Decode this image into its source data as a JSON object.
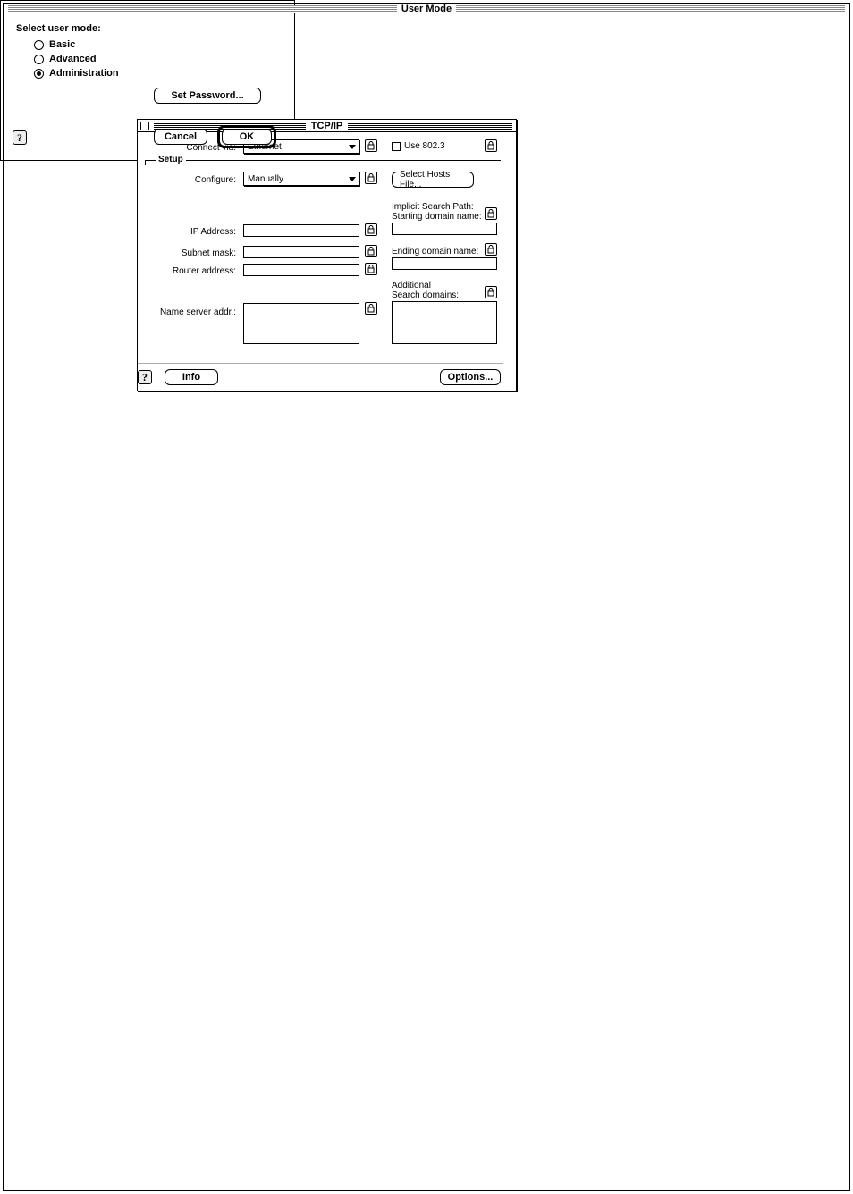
{
  "tcpip": {
    "title": "TCP/IP",
    "labels": {
      "connect_via": "Connect via:",
      "setup": "Setup",
      "configure": "Configure:",
      "ip_address": "IP Address:",
      "subnet_mask": "Subnet mask:",
      "router_address": "Router address:",
      "name_server": "Name server addr.:",
      "use_8023": "Use 802.3",
      "select_hosts": "Select Hosts File...",
      "implicit_search": "Implicit Search Path:",
      "starting_domain": "Starting domain name:",
      "ending_domain": "Ending domain name:",
      "additional": "Additional",
      "search_domains": "Search domains:"
    },
    "values": {
      "connect_via": "Ethernet",
      "configure": "Manually",
      "ip_address": "",
      "subnet_mask": "",
      "router_address": "",
      "name_server": "",
      "starting_domain": "",
      "ending_domain": "",
      "search_domains": ""
    },
    "buttons": {
      "info": "Info",
      "options": "Options..."
    }
  },
  "usermode": {
    "title": "User Mode",
    "heading": "Select user mode:",
    "options": {
      "basic": "Basic",
      "advanced": "Advanced",
      "administration": "Administration"
    },
    "selected": "administration",
    "buttons": {
      "set_password": "Set Password...",
      "cancel": "Cancel",
      "ok": "OK"
    }
  }
}
